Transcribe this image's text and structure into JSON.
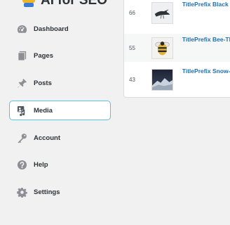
{
  "brand": {
    "name": "AI for SEO",
    "logo_icon": "robot-logo-icon"
  },
  "sidebar": {
    "items": [
      {
        "label": "Dashboard",
        "icon": "dashboard-icon",
        "active": false
      },
      {
        "label": "Pages",
        "icon": "pages-icon",
        "active": false
      },
      {
        "label": "Posts",
        "icon": "pin-icon",
        "active": false
      },
      {
        "label": "Media",
        "icon": "media-icon",
        "active": true
      },
      {
        "label": "Account",
        "icon": "key-icon",
        "active": false
      },
      {
        "label": "Help",
        "icon": "help-icon",
        "active": false
      },
      {
        "label": "Settings",
        "icon": "gear-icon",
        "active": false
      }
    ],
    "active_border_color": "#62bfd8"
  },
  "media_table": {
    "rows": [
      {
        "id": "66",
        "title": "TitlePrefix Black A",
        "thumb": "black-bird-thumbnail"
      },
      {
        "id": "55",
        "title": "TitlePrefix Bee-Th",
        "thumb": "bee-thumbnail"
      },
      {
        "id": "43",
        "title": "TitlePrefix Snow-C",
        "thumb": "snowy-mountain-thumbnail"
      }
    ],
    "link_color": "#2271b1"
  }
}
